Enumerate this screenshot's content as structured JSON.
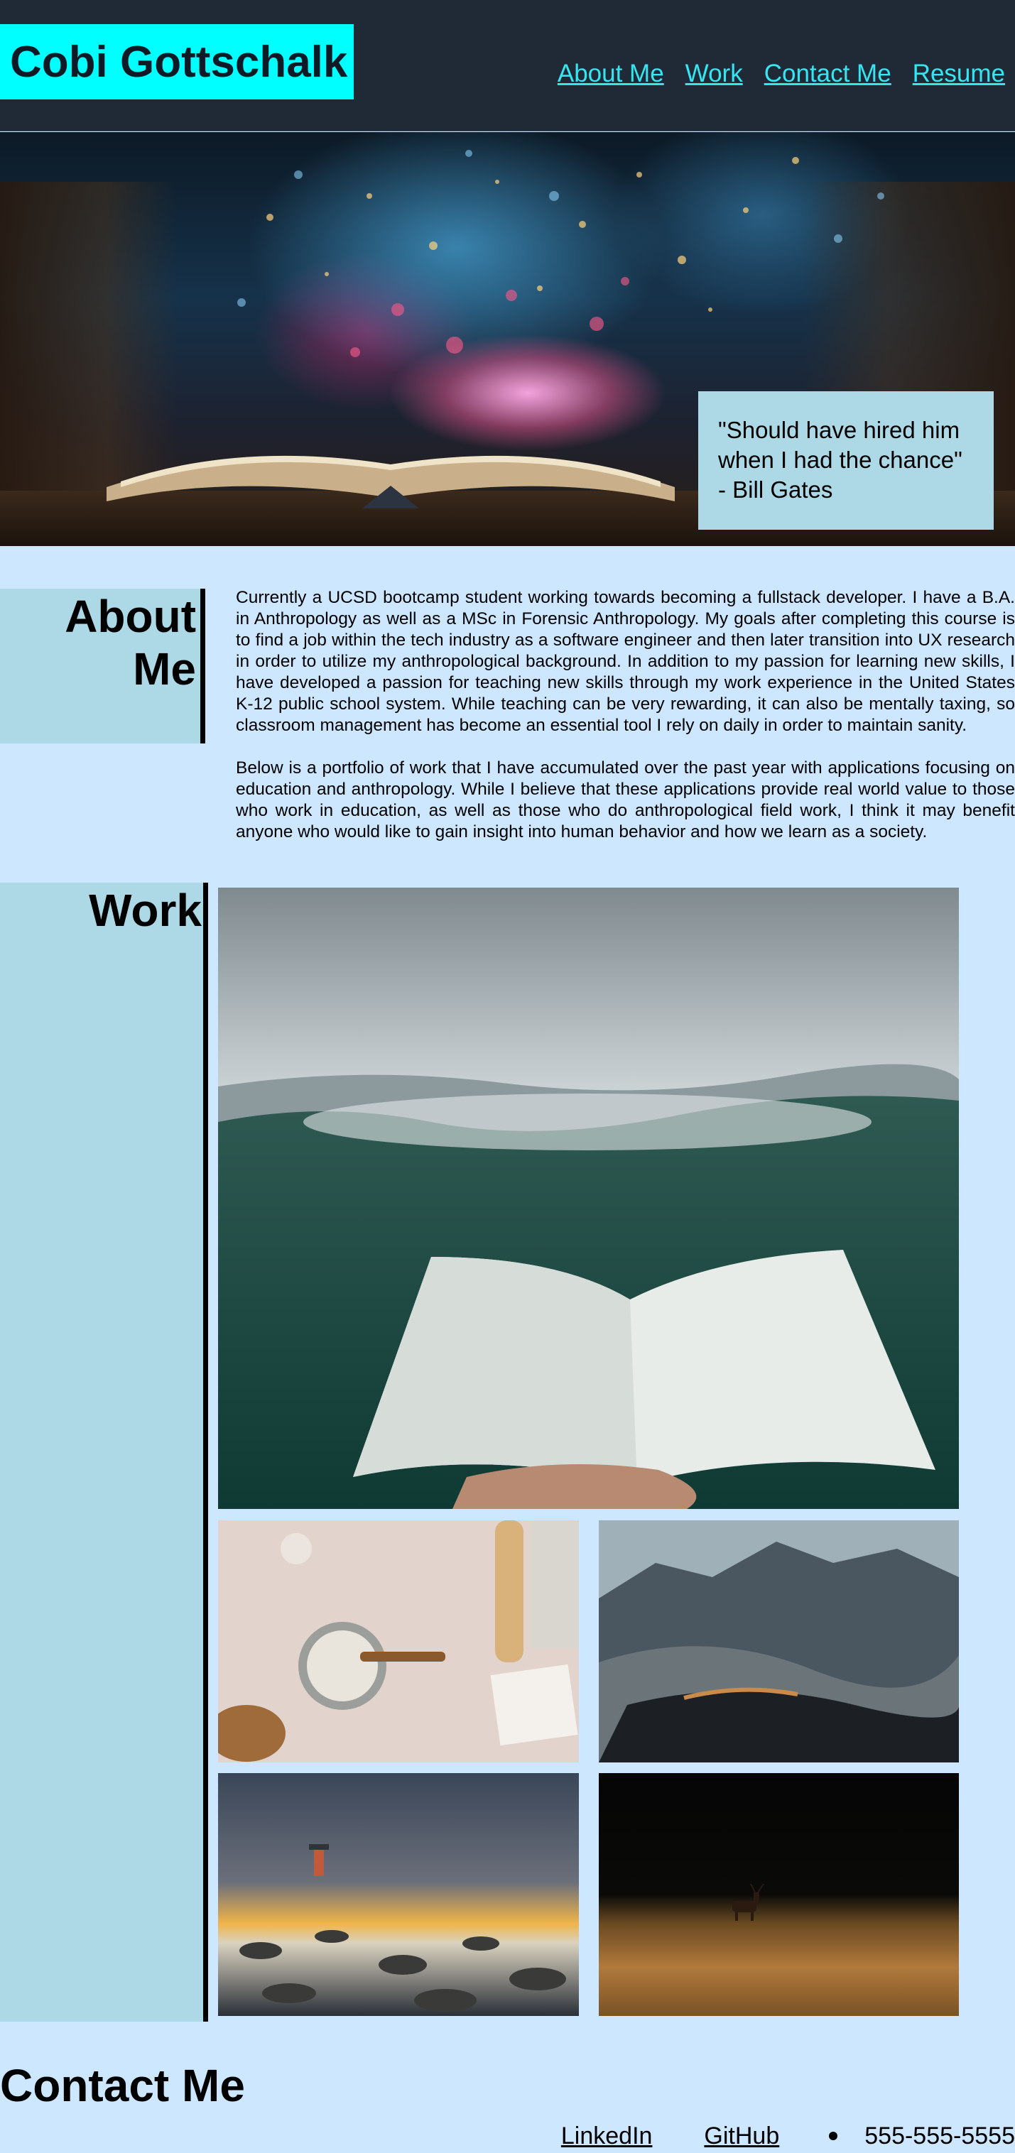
{
  "header": {
    "brand": "Cobi Gottschalk",
    "nav": [
      "About Me",
      "Work",
      "Contact Me",
      "Resume"
    ]
  },
  "hero": {
    "image_icon": "open-book-bokeh-image",
    "quote_line1": "\"Should have hired him",
    "quote_line2": "when I had the chance\"",
    "quote_line3": "- Bill Gates"
  },
  "about": {
    "heading_line1": "About",
    "heading_line2": "Me",
    "paragraph1": "Currently a UCSD bootcamp student working towards becoming a fullstack developer. I have a B.A. in Anthropology as well as a MSc in Forensic Anthropology. My goals after completing this course is to find a job within the tech industry as a software engineer and then later transition into UX research in order to utilize my anthropological background. In addition to my passion for learning new skills, I have developed a passion for teaching new skills through my work experience in the United States K-12 public school system. While teaching can be very rewarding, it can also be mentally taxing, so classroom management has become an essential tool I rely on daily in order to maintain sanity.",
    "paragraph2": "Below is a portfolio of work that I have accumulated over the past year with applications focusing on education and anthropology. While I believe that these applications provide real world value to those who work in education, as well as those who do anthropological field work, I think it may benefit anyone who would like to gain insight into human behavior and how we learn as a society."
  },
  "work": {
    "heading": "Work",
    "tiles": [
      {
        "icon": "open-book-mountain-image"
      },
      {
        "icon": "baking-flour-image"
      },
      {
        "icon": "rocky-mountain-image"
      },
      {
        "icon": "lighthouse-sunset-image"
      },
      {
        "icon": "deer-field-image"
      }
    ]
  },
  "contact": {
    "heading": "Contact Me",
    "linkedin": "LinkedIn",
    "github": "GitHub",
    "phone": "555-555-5555"
  },
  "colors": {
    "page_bg": "#cce7ff",
    "header_bg": "#1f2a36",
    "brand_bg": "#00ffff",
    "nav_link": "#33e6f2",
    "panel_bg": "#add8e6"
  }
}
